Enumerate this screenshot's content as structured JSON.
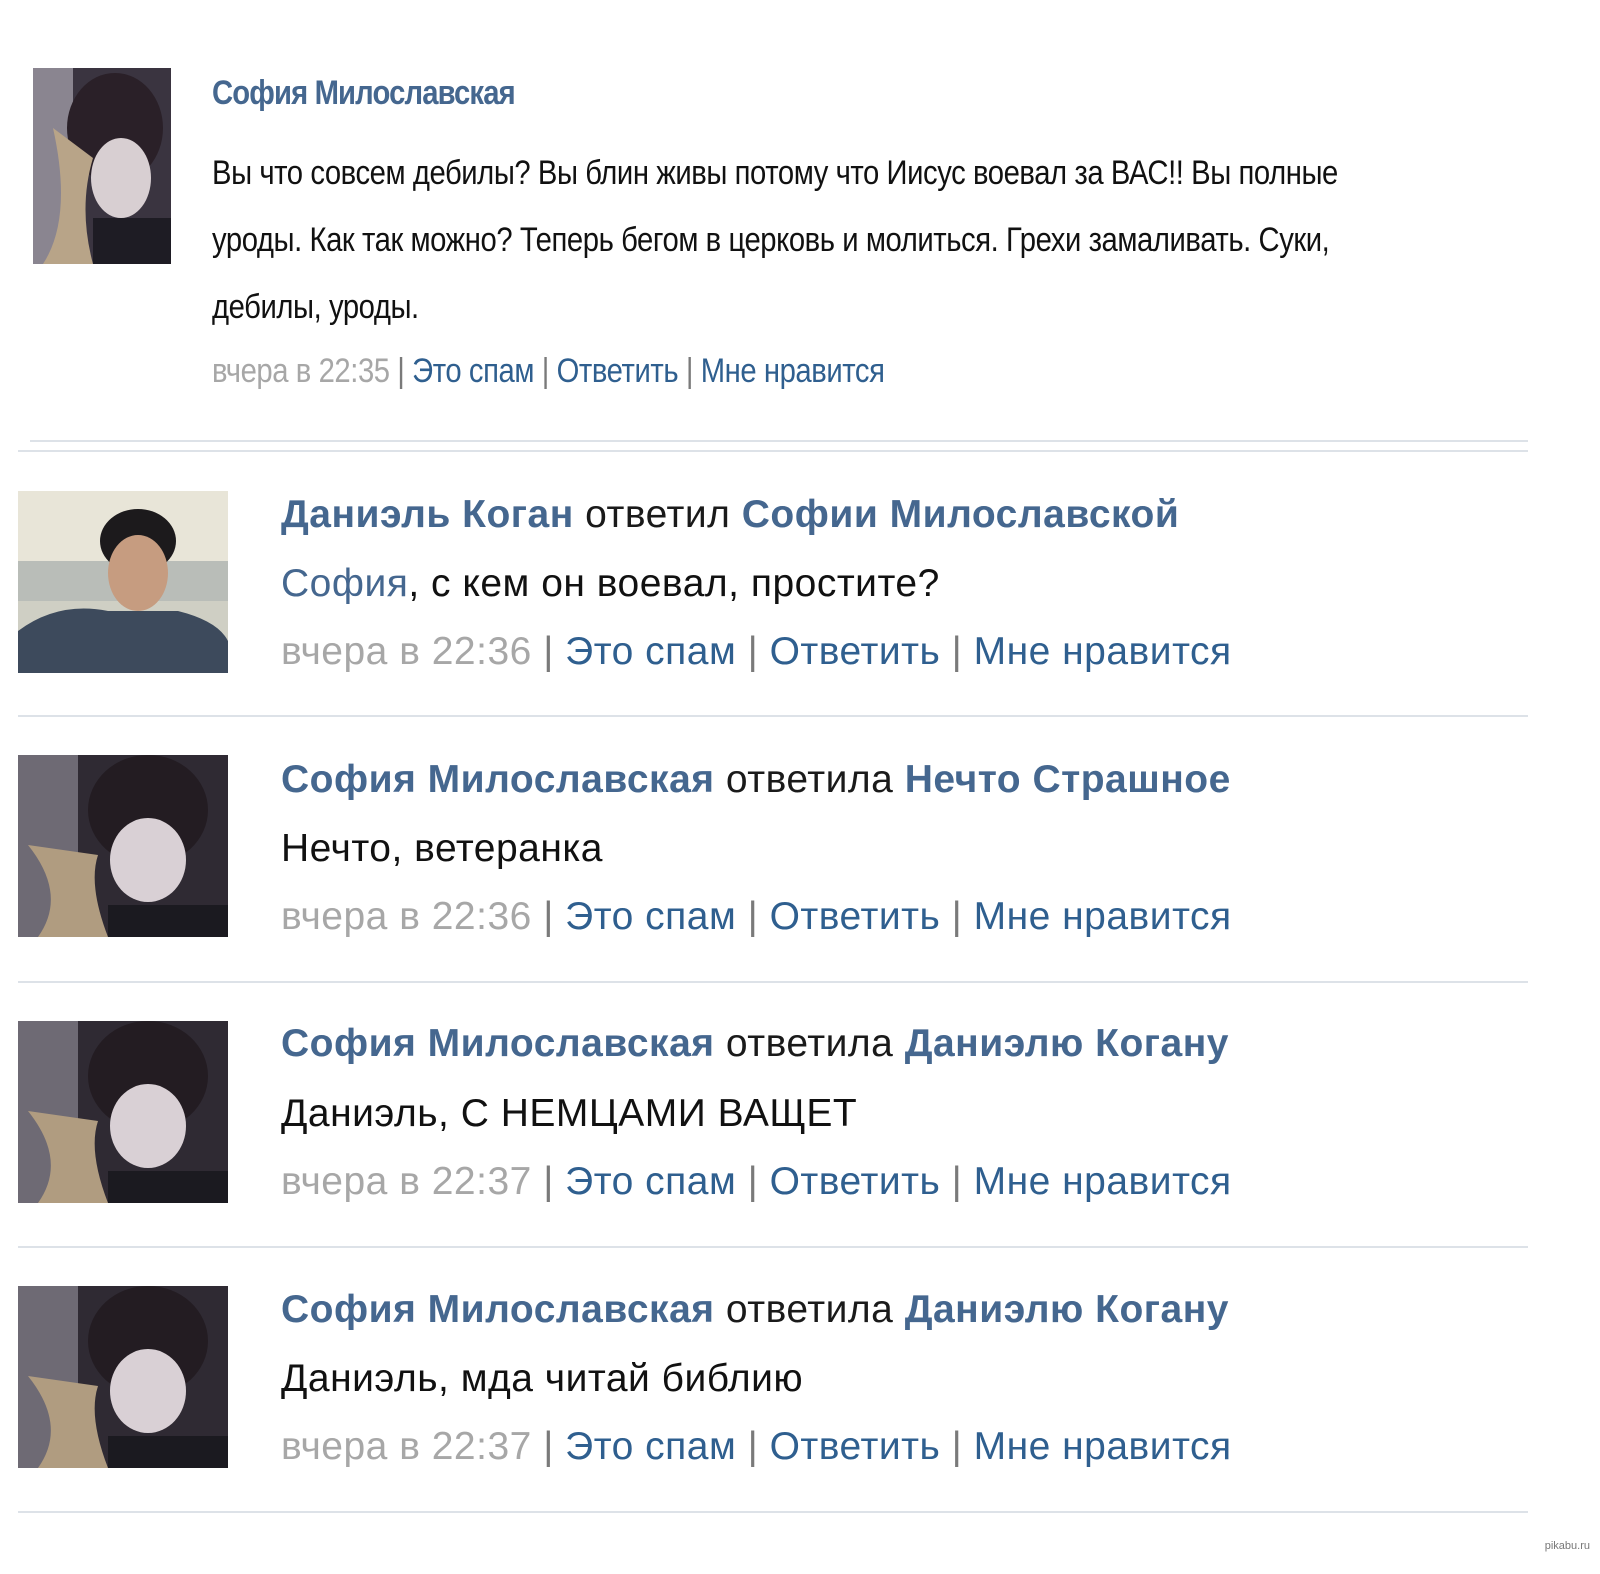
{
  "comments": [
    {
      "author": "София Милославская",
      "text": "Вы что совсем дебилы? Вы блин живы потому что Иисус воевал за ВАС!! Вы полные уроды. Как так можно? Теперь бегом в церковь и молиться. Грехи замаливать. Суки, дебилы, уроды.",
      "time": "вчера в 22:35",
      "spam": "Это спам",
      "reply": "Ответить",
      "like": "Мне нравится"
    },
    {
      "author": "Даниэль Коган",
      "verb": "ответил",
      "target": "Софии Милославской",
      "mention": "София",
      "text": ", с кем он воевал, простите?",
      "time": "вчера в 22:36",
      "spam": "Это спам",
      "reply": "Ответить",
      "like": "Мне нравится"
    },
    {
      "author": "София Милославская",
      "verb": "ответила",
      "target": "Нечто Страшное",
      "text": "Нечто, ветеранка",
      "time": "вчера в 22:36",
      "spam": "Это спам",
      "reply": "Ответить",
      "like": "Мне нравится"
    },
    {
      "author": "София Милославская",
      "verb": "ответила",
      "target": "Даниэлю Когану",
      "text": "Даниэль, С НЕМЦАМИ ВАЩЕТ",
      "time": "вчера в 22:37",
      "spam": "Это спам",
      "reply": "Ответить",
      "like": "Мне нравится"
    },
    {
      "author": "София Милославская",
      "verb": "ответила",
      "target": "Даниэлю Когану",
      "text": "Даниэль, мда читай библию",
      "time": "вчера в 22:37",
      "spam": "Это спам",
      "reply": "Ответить",
      "like": "Мне нравится"
    }
  ],
  "watermark": "pikabu.ru",
  "colors": {
    "name": "#45678f",
    "link": "#2f5f8f",
    "meta": "#a7a7a7",
    "divider": "#dde2e8"
  }
}
